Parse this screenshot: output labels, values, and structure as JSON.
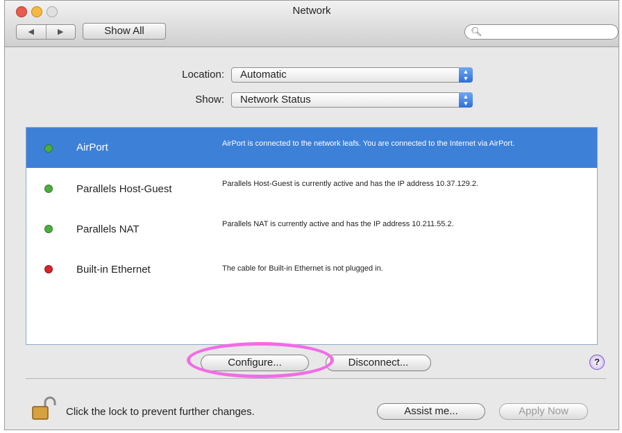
{
  "window": {
    "title": "Network"
  },
  "toolbar": {
    "back_glyph": "◀",
    "forward_glyph": "▶",
    "show_all_label": "Show All",
    "search_placeholder": "",
    "search_icon": "magnifier-icon"
  },
  "location": {
    "label": "Location:",
    "value": "Automatic"
  },
  "show": {
    "label": "Show:",
    "value": "Network Status"
  },
  "services": [
    {
      "name": "AirPort",
      "status": "green",
      "description": "AirPort is connected to the network leafs. You are connected to the Internet via AirPort.",
      "selected": true
    },
    {
      "name": "Parallels Host-Guest",
      "status": "green",
      "description": "Parallels Host-Guest is currently active and has the IP address 10.37.129.2.",
      "selected": false
    },
    {
      "name": "Parallels NAT",
      "status": "green",
      "description": "Parallels NAT is currently active and has the IP address 10.211.55.2.",
      "selected": false
    },
    {
      "name": "Built-in Ethernet",
      "status": "red",
      "description": "The cable for Built-in Ethernet is not plugged in.",
      "selected": false
    }
  ],
  "buttons": {
    "configure": "Configure...",
    "disconnect": "Disconnect...",
    "help": "?",
    "assist": "Assist me...",
    "apply": "Apply Now"
  },
  "lock": {
    "text": "Click the lock to prevent further changes."
  },
  "colors": {
    "selection": "#3d80d8",
    "status_green": "#4cae3f",
    "status_red": "#d8232a",
    "highlight_ring": "#f06de6"
  }
}
